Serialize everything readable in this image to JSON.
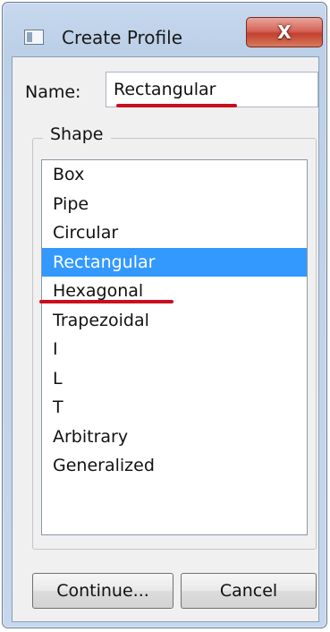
{
  "window": {
    "title": "Create Profile",
    "close_glyph": "X",
    "icon": "window-app-icon"
  },
  "form": {
    "name_label": "Name:",
    "name_value": "Rectangular"
  },
  "shape": {
    "group_label": "Shape",
    "options": [
      "Box",
      "Pipe",
      "Circular",
      "Rectangular",
      "Hexagonal",
      "Trapezoidal",
      "I",
      "L",
      "T",
      "Arbitrary",
      "Generalized"
    ],
    "selected": "Rectangular"
  },
  "buttons": {
    "continue_label": "Continue...",
    "cancel_label": "Cancel"
  },
  "colors": {
    "selection": "#3399ff",
    "annotation_underline": "#c8101f",
    "close_button": "#c2412f"
  }
}
